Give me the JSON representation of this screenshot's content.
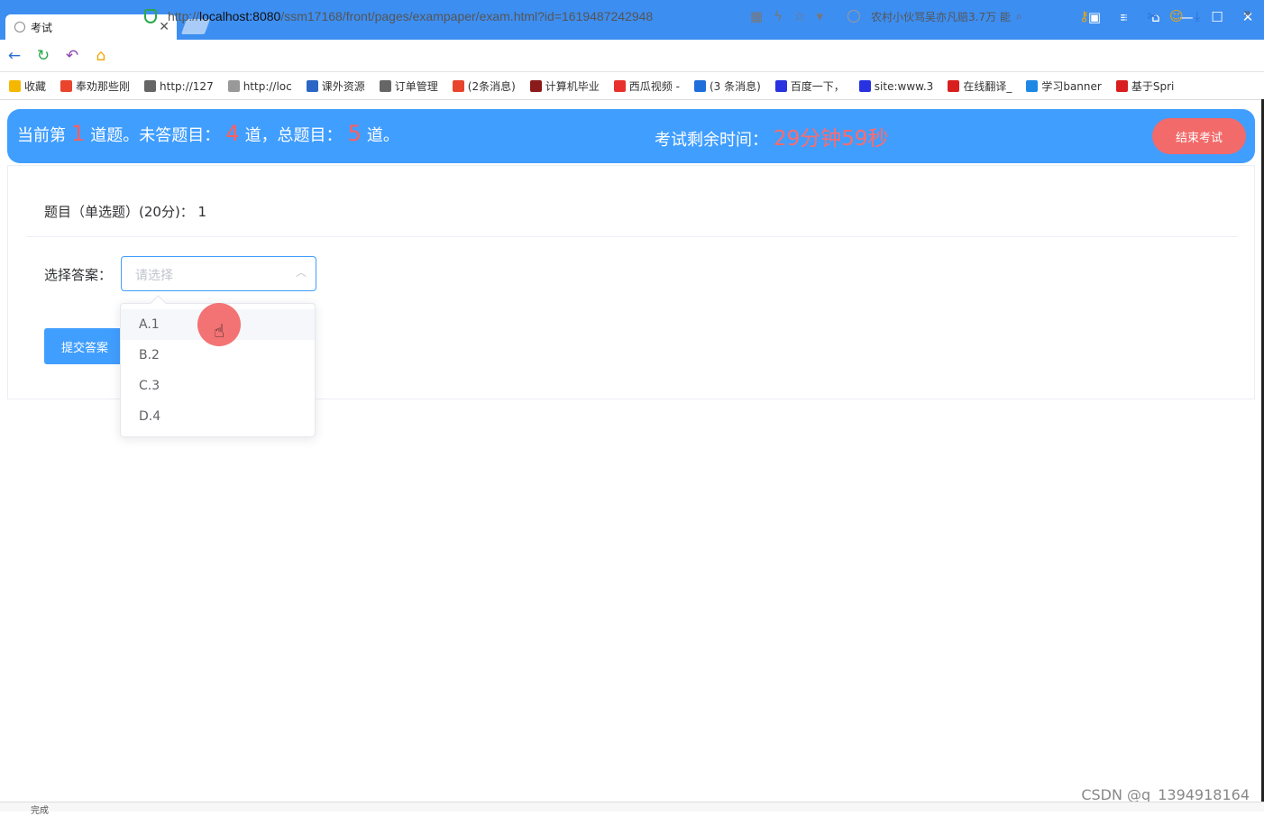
{
  "browser": {
    "tab_title": "考试",
    "url_prefix": "http://",
    "url_host": "localhost:8080",
    "url_path": "/ssm17168/front/pages/exampaper/exam.html?id=1619487242948",
    "search_text": "农村小伙骂吴亦凡赔3.7万 能"
  },
  "bookmarks": [
    {
      "label": "收藏",
      "color": "#f5b800"
    },
    {
      "label": "奉劝那些刚",
      "color": "#e8452c"
    },
    {
      "label": "http://127",
      "color": "#666666"
    },
    {
      "label": "http://loc",
      "color": "#999999"
    },
    {
      "label": "课外资源",
      "color": "#2b66c4"
    },
    {
      "label": "订单管理",
      "color": "#666666"
    },
    {
      "label": "(2条消息)",
      "color": "#e8452c"
    },
    {
      "label": "计算机毕业",
      "color": "#8b1a1a"
    },
    {
      "label": "西瓜视频 -",
      "color": "#e8312c"
    },
    {
      "label": "(3 条消息)",
      "color": "#1e6fd9"
    },
    {
      "label": "百度一下，",
      "color": "#2932e1"
    },
    {
      "label": "site:www.3",
      "color": "#2932e1"
    },
    {
      "label": "在线翻译_",
      "color": "#d81e1e"
    },
    {
      "label": "学习banner",
      "color": "#1e88e5"
    },
    {
      "label": "基于Spri",
      "color": "#d81e1e"
    }
  ],
  "header": {
    "prefix": "当前第",
    "current": "1",
    "unanswered_label": "道题。未答题目：",
    "unanswered": "4",
    "total_label": "道，总题目：",
    "total": "5",
    "suffix": "道。",
    "timer_label": "考试剩余时间：",
    "timer_value": "29分钟59秒",
    "end_button": "结束考试"
  },
  "question": {
    "text": "题目（单选题）(20分)：  1",
    "answer_label": "选择答案：",
    "select_placeholder": "请选择",
    "submit_button": "提交答案",
    "options": [
      "A.1",
      "B.2",
      "C.3",
      "D.4"
    ]
  },
  "watermark": "CSDN @q_1394918164",
  "status": "完成"
}
